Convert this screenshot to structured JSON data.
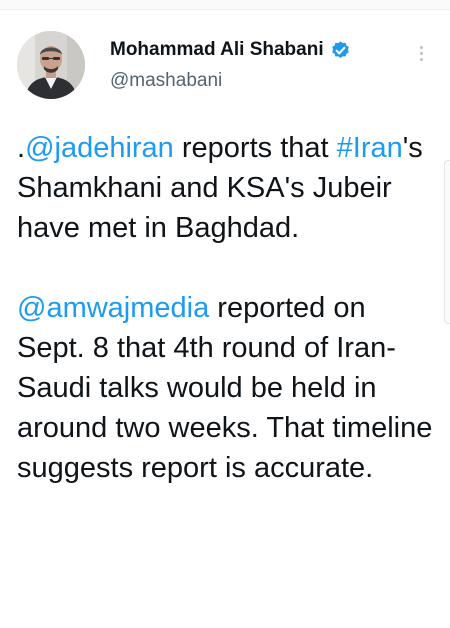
{
  "tweet": {
    "author": {
      "display_name": "Mohammad Ali Shabani",
      "handle": "@mashabani",
      "verified_icon": "verified-badge-icon",
      "avatar": "avatar-photo"
    },
    "menu_icon": "more-options-icon",
    "paragraph1": {
      "prefix": ".",
      "mention": "@jadehiran",
      "text1": " reports that ",
      "hashtag": "#Iran",
      "text2": "'s Shamkhani and KSA's Jubeir have met in Baghdad."
    },
    "paragraph2": {
      "mention": "@amwajmedia",
      "text": " reported on Sept. 8 that 4th round of Iran-Saudi talks would be held in around two weeks. That timeline suggests report is accurate."
    }
  },
  "colors": {
    "link": "#1d9bf0",
    "text": "#0f1419",
    "secondary": "#536471"
  }
}
